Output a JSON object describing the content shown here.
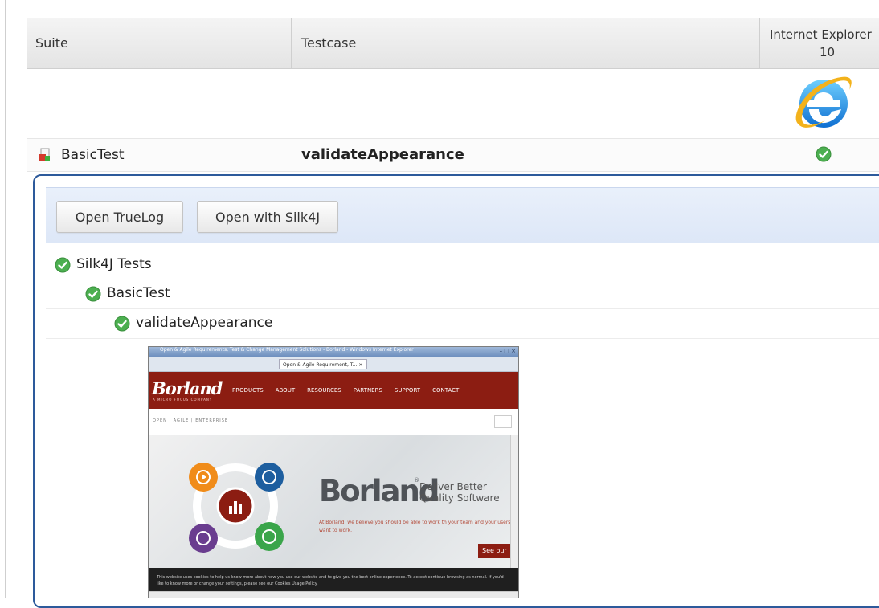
{
  "table": {
    "headers": {
      "suite": "Suite",
      "testcase": "Testcase",
      "browser_line1": "Internet Explorer",
      "browser_line2": "10"
    },
    "browser_icon": "internet-explorer-icon",
    "result": {
      "suite": "BasicTest",
      "testcase": "validateAppearance",
      "status": "passed"
    }
  },
  "details": {
    "buttons": {
      "open_truelog": "Open TrueLog",
      "open_silk4j": "Open with Silk4J"
    },
    "tree": [
      {
        "label": "Silk4J Tests",
        "status": "passed"
      },
      {
        "label": "BasicTest",
        "status": "passed"
      },
      {
        "label": "validateAppearance",
        "status": "passed"
      }
    ]
  },
  "screenshot": {
    "window_title": "Open & Agile Requirements, Test & Change Management Solutions - Borland - Windows Internet Explorer",
    "window_buttons": "– □ ×",
    "tab_label": "Open & Agile Requirement, T... ×",
    "logo": "Borland",
    "logo_sub": "A MICRO FOCUS COMPANY",
    "menu": [
      "PRODUCTS",
      "ABOUT",
      "RESOURCES",
      "PARTNERS",
      "SUPPORT",
      "CONTACT"
    ],
    "breadcrumb": "OPEN | AGILE | ENTERPRISE",
    "brand": "Borland",
    "brand_mark": "®",
    "tagline_1": "Deliver Better",
    "tagline_2": "Quality Software",
    "blurb": "At Borland, we believe you should be able to work th your team and your users want to work.",
    "cta": "See our",
    "cookie": "This website uses cookies to help us know more about how you use our website and to give you the best online experience. To accept continue browsing as normal. If you'd like to know more or change your settings, please see our Cookies Usage Policy.",
    "colors": {
      "nav": "#8c1d12",
      "accent": "#2d5a9b",
      "pass": "#4caf50"
    }
  }
}
